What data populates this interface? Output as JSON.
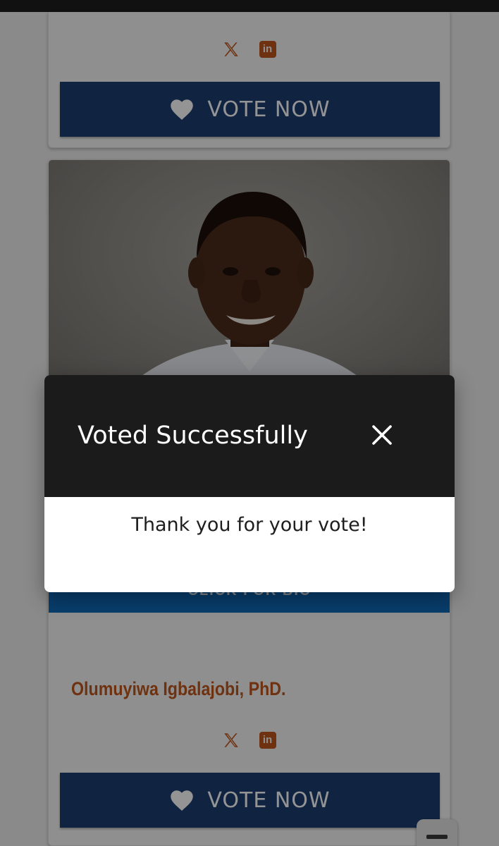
{
  "status_bar": {},
  "cards": [
    {
      "social": [
        "x-icon",
        "linkedin-icon"
      ],
      "vote_label": "VOTE NOW"
    },
    {
      "photo_alt": "",
      "bio_label": "CLICK FOR BIO",
      "name": "Olumuyiwa Igbalajobi, PhD.",
      "social": [
        "x-icon",
        "linkedin-icon"
      ],
      "vote_label": "VOTE NOW"
    }
  ],
  "social_linkedin_text": "in",
  "modal": {
    "title": "Voted Successfully",
    "message": "Thank you for your vote!"
  },
  "colors": {
    "accent_orange": "#c0561c",
    "vote_blue": "#1c3f73",
    "bio_blue": "#0f6ab8",
    "modal_header": "#1b1b1b"
  }
}
